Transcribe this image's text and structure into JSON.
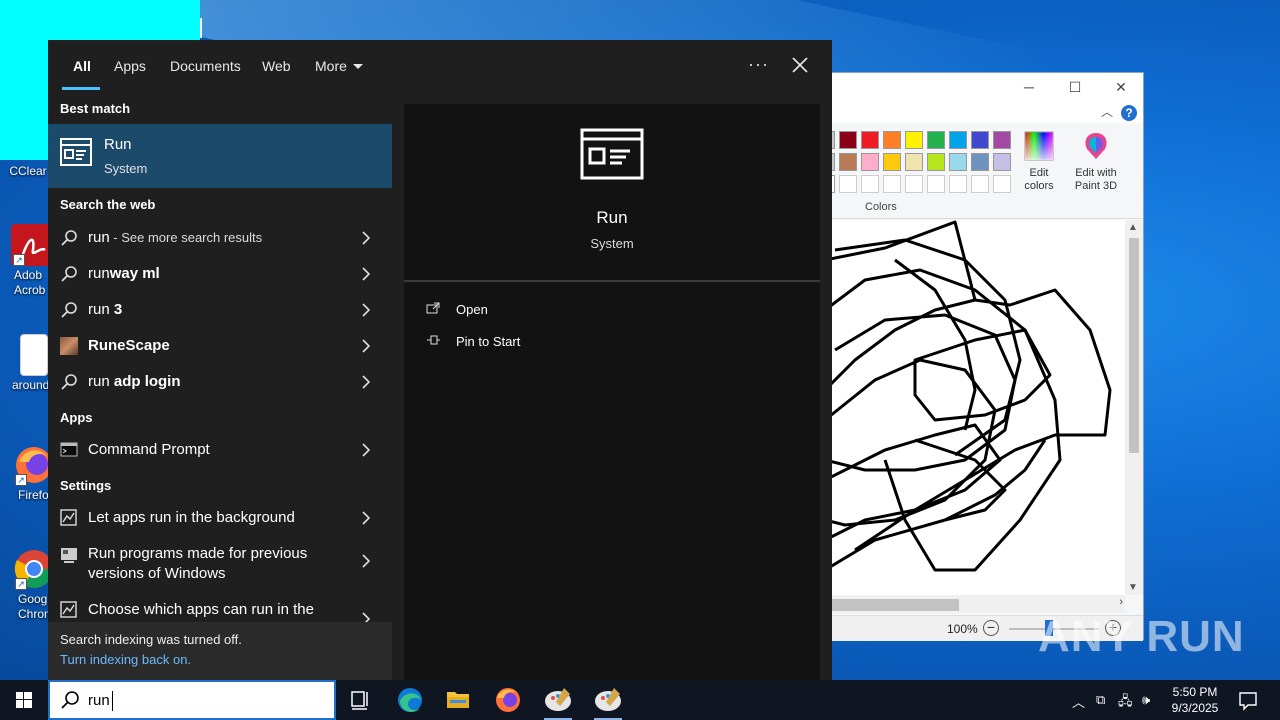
{
  "desktop": {
    "icons": [
      {
        "label": "CCleaner",
        "display": "CClear"
      },
      {
        "label": "Adobe Acrobat",
        "display": "Adob\nAcrob"
      },
      {
        "label": "arounde",
        "display": "arounde"
      },
      {
        "label": "Firefox",
        "display": "Firefo"
      },
      {
        "label": "Google Chrome",
        "display": "Googl\nChron"
      }
    ]
  },
  "paint": {
    "colors_group_label": "Colors",
    "edit_colors_label": "Edit colors",
    "edit_paint3d_label": "Edit with Paint 3D",
    "zoom": "100%",
    "palette_row1": [
      "#880015",
      "#ed1c24",
      "#ff7f27",
      "#fff200",
      "#22b14c",
      "#00a2e8",
      "#3f48cc",
      "#a349a4"
    ],
    "palette_row2": [
      "#b97a57",
      "#ffaec9",
      "#ffc90e",
      "#efe4b0",
      "#b5e61d",
      "#99d9ea",
      "#7092be",
      "#c8bfe7"
    ]
  },
  "search": {
    "tabs": [
      "All",
      "Apps",
      "Documents",
      "Web",
      "More"
    ],
    "best_match_header": "Best match",
    "best_match": {
      "name": "Run",
      "sub": "System"
    },
    "web_header": "Search the web",
    "web_results": [
      {
        "prefix": "run",
        "suffix": " - See more search results"
      },
      {
        "prefix": "run",
        "bold": "way ml"
      },
      {
        "prefix": "run",
        "bold": " 3"
      },
      {
        "prefix": "RuneScape",
        "bold": ""
      },
      {
        "prefix": "run",
        "bold": " adp login"
      }
    ],
    "apps_header": "Apps",
    "apps": [
      "Command Prompt"
    ],
    "settings_header": "Settings",
    "settings": [
      "Let apps run in the background",
      "Run programs made for previous versions of Windows",
      "Choose which apps can run in the"
    ],
    "index_note": "Search indexing was turned off.",
    "index_link": "Turn indexing back on.",
    "detail": {
      "name": "Run",
      "sub": "System",
      "actions": [
        "Open",
        "Pin to Start"
      ]
    }
  },
  "taskbar": {
    "search_value": "run",
    "time": "5:50 PM",
    "date": "9/3/2025"
  },
  "watermark": "ANY RUN",
  "colors": {
    "accent": "#4cc2ff",
    "selected": "#1c4a6b",
    "link": "#6cb8ff"
  }
}
